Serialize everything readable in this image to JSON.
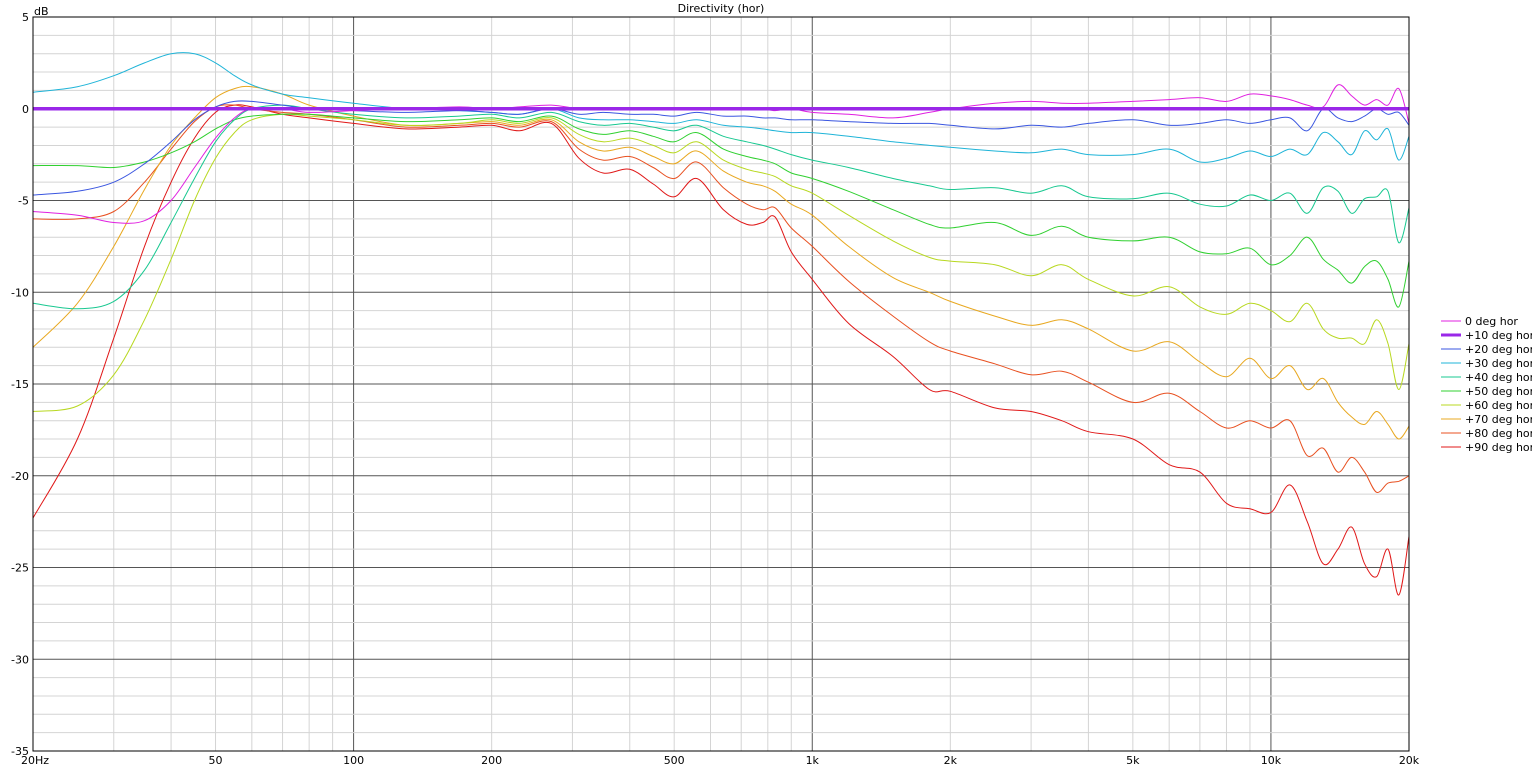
{
  "chart_data": {
    "type": "line",
    "title": "Directivity (hor)",
    "ylabel": "dB",
    "xlabel": "",
    "xscale": "log",
    "xlim": [
      20,
      20000
    ],
    "ylim": [
      -35,
      5
    ],
    "grid": true,
    "legend_placement": "right",
    "x_ticks": [
      {
        "v": 20,
        "label": "20Hz"
      },
      {
        "v": 50,
        "label": "50"
      },
      {
        "v": 100,
        "label": "100"
      },
      {
        "v": 200,
        "label": "200"
      },
      {
        "v": 500,
        "label": "500"
      },
      {
        "v": 1000,
        "label": "1k"
      },
      {
        "v": 2000,
        "label": "2k"
      },
      {
        "v": 5000,
        "label": "5k"
      },
      {
        "v": 10000,
        "label": "10k"
      },
      {
        "v": 20000,
        "label": "20k"
      }
    ],
    "y_ticks": [
      {
        "v": 5,
        "label": "5"
      },
      {
        "v": 0,
        "label": "0"
      },
      {
        "v": -5,
        "label": "-5"
      },
      {
        "v": -10,
        "label": "-10"
      },
      {
        "v": -15,
        "label": "-15"
      },
      {
        "v": -20,
        "label": "-20"
      },
      {
        "v": -25,
        "label": "-25"
      },
      {
        "v": -30,
        "label": "-30"
      },
      {
        "v": -35,
        "label": "-35"
      }
    ],
    "x": [
      20,
      25,
      30,
      35,
      40,
      45,
      50,
      55,
      60,
      70,
      80,
      100,
      130,
      170,
      200,
      230,
      270,
      310,
      350,
      400,
      450,
      500,
      560,
      640,
      720,
      780,
      830,
      900,
      1000,
      1200,
      1500,
      1800,
      2000,
      2500,
      3000,
      3500,
      4000,
      5000,
      6000,
      7000,
      8000,
      9000,
      10000,
      11000,
      12000,
      13000,
      14000,
      15000,
      16000,
      17000,
      18000,
      19000,
      20000
    ],
    "series": [
      {
        "name": "0 deg hor",
        "color": "#e020e0",
        "width": 1,
        "values": [
          -5.6,
          -5.8,
          -6.2,
          -6.1,
          -5,
          -3.2,
          -1.6,
          -0.5,
          0,
          0,
          -0.2,
          -0.1,
          0,
          0.1,
          0,
          0.1,
          0.2,
          0,
          0,
          0,
          0,
          0,
          0,
          0,
          0,
          0,
          -0.1,
          0,
          -0.2,
          -0.3,
          -0.5,
          -0.2,
          0,
          0.3,
          0.4,
          0.3,
          0.3,
          0.4,
          0.5,
          0.6,
          0.4,
          0.8,
          0.7,
          0.5,
          0.2,
          0.1,
          1.3,
          0.7,
          0.2,
          0.5,
          0.2,
          1.1,
          -0.8
        ]
      },
      {
        "name": "+10 deg hor",
        "color": "#9a28e8",
        "width": 3.5,
        "values": [
          0,
          0,
          0,
          0,
          0,
          0,
          0,
          0,
          0,
          0,
          0,
          0,
          0,
          0,
          0,
          0,
          0,
          0,
          0,
          0,
          0,
          0,
          0,
          0,
          0,
          0,
          0,
          0,
          0,
          0,
          0,
          0,
          0,
          0,
          0,
          0,
          0,
          0,
          0,
          0,
          0,
          0,
          0,
          0,
          0,
          0,
          0,
          0,
          0,
          0,
          0,
          0,
          0
        ]
      },
      {
        "name": "+20 deg hor",
        "color": "#3a56e0",
        "width": 1,
        "values": [
          -4.7,
          -4.5,
          -4.0,
          -3.0,
          -1.8,
          -0.6,
          0.1,
          0.4,
          0.4,
          0.2,
          0,
          -0.1,
          -0.2,
          -0.1,
          -0.2,
          -0.3,
          0,
          -0.3,
          -0.2,
          -0.3,
          -0.3,
          -0.4,
          -0.2,
          -0.4,
          -0.4,
          -0.5,
          -0.5,
          -0.6,
          -0.6,
          -0.7,
          -0.8,
          -0.8,
          -0.9,
          -1.1,
          -0.9,
          -1.0,
          -0.8,
          -0.6,
          -0.9,
          -0.8,
          -0.6,
          -0.8,
          -0.6,
          -0.5,
          -1.2,
          0,
          -0.5,
          -0.7,
          -0.4,
          0,
          -0.3,
          -0.2,
          -0.9
        ]
      },
      {
        "name": "+30 deg hor",
        "color": "#1fb4d8",
        "width": 1,
        "values": [
          0.9,
          1.2,
          1.8,
          2.5,
          3.0,
          3.0,
          2.5,
          1.8,
          1.3,
          0.8,
          0.6,
          0.3,
          0,
          -0.1,
          -0.2,
          -0.3,
          0,
          -0.5,
          -0.6,
          -0.6,
          -0.7,
          -0.8,
          -0.6,
          -0.9,
          -1.0,
          -1.1,
          -1.2,
          -1.3,
          -1.3,
          -1.5,
          -1.8,
          -2.0,
          -2.1,
          -2.3,
          -2.4,
          -2.2,
          -2.5,
          -2.5,
          -2.2,
          -2.9,
          -2.7,
          -2.3,
          -2.6,
          -2.2,
          -2.5,
          -1.3,
          -1.8,
          -2.5,
          -1.2,
          -1.7,
          -1.1,
          -2.8,
          -1.5
        ]
      },
      {
        "name": "+40 deg hor",
        "color": "#18c890",
        "width": 1,
        "values": [
          -10.6,
          -10.9,
          -10.5,
          -8.8,
          -6.2,
          -3.8,
          -1.8,
          -0.6,
          0,
          0.2,
          0,
          -0.3,
          -0.5,
          -0.4,
          -0.3,
          -0.5,
          -0.2,
          -0.7,
          -0.9,
          -0.8,
          -1.0,
          -1.2,
          -0.9,
          -1.5,
          -1.8,
          -2.0,
          -2.2,
          -2.5,
          -2.8,
          -3.2,
          -3.8,
          -4.2,
          -4.4,
          -4.3,
          -4.6,
          -4.2,
          -4.8,
          -4.9,
          -4.6,
          -5.2,
          -5.3,
          -4.7,
          -5.0,
          -4.6,
          -5.7,
          -4.3,
          -4.5,
          -5.7,
          -4.9,
          -4.8,
          -4.5,
          -7.3,
          -5.4
        ]
      },
      {
        "name": "+50 deg hor",
        "color": "#30d030",
        "width": 1,
        "values": [
          -3.1,
          -3.1,
          -3.2,
          -2.9,
          -2.4,
          -1.8,
          -1.1,
          -0.6,
          -0.4,
          -0.3,
          -0.3,
          -0.5,
          -0.7,
          -0.6,
          -0.5,
          -0.7,
          -0.4,
          -1.1,
          -1.4,
          -1.2,
          -1.5,
          -1.8,
          -1.3,
          -2.2,
          -2.6,
          -2.8,
          -3.0,
          -3.5,
          -3.8,
          -4.5,
          -5.5,
          -6.3,
          -6.5,
          -6.2,
          -6.9,
          -6.4,
          -7.0,
          -7.2,
          -7.0,
          -7.8,
          -7.9,
          -7.6,
          -8.5,
          -8.0,
          -7.0,
          -8.2,
          -8.8,
          -9.5,
          -8.6,
          -8.3,
          -9.3,
          -10.8,
          -8.3
        ]
      },
      {
        "name": "+60 deg hor",
        "color": "#b8d820",
        "width": 1,
        "values": [
          -16.5,
          -16.2,
          -14.5,
          -11.5,
          -8.2,
          -5.0,
          -2.7,
          -1.3,
          -0.6,
          -0.3,
          -0.4,
          -0.6,
          -0.9,
          -0.8,
          -0.6,
          -0.8,
          -0.5,
          -1.4,
          -1.8,
          -1.6,
          -2.0,
          -2.4,
          -1.8,
          -2.8,
          -3.3,
          -3.5,
          -3.7,
          -4.2,
          -4.6,
          -5.8,
          -7.2,
          -8.1,
          -8.3,
          -8.5,
          -9.1,
          -8.5,
          -9.3,
          -10.2,
          -9.7,
          -10.8,
          -11.2,
          -10.6,
          -11.0,
          -11.6,
          -10.6,
          -12.0,
          -12.5,
          -12.5,
          -12.8,
          -11.5,
          -12.8,
          -15.3,
          -12.8
        ]
      },
      {
        "name": "+70 deg hor",
        "color": "#e8a820",
        "width": 1,
        "values": [
          -13.0,
          -10.6,
          -7.5,
          -4.4,
          -2.0,
          -0.5,
          0.6,
          1.1,
          1.2,
          0.8,
          0.2,
          -0.4,
          -0.9,
          -0.8,
          -0.7,
          -0.9,
          -0.6,
          -1.8,
          -2.3,
          -2.1,
          -2.6,
          -3.0,
          -2.3,
          -3.4,
          -4.0,
          -4.2,
          -4.5,
          -5.2,
          -5.8,
          -7.5,
          -9.2,
          -10.0,
          -10.5,
          -11.3,
          -11.8,
          -11.5,
          -12.0,
          -13.2,
          -12.7,
          -13.8,
          -14.6,
          -13.6,
          -14.7,
          -14.0,
          -15.3,
          -14.7,
          -16.0,
          -16.8,
          -17.2,
          -16.5,
          -17.2,
          -18.0,
          -17.3
        ]
      },
      {
        "name": "+80 deg hor",
        "color": "#e85020",
        "width": 1,
        "values": [
          -6.0,
          -6.0,
          -5.6,
          -4.0,
          -2.2,
          -0.7,
          0.1,
          0.2,
          0,
          -0.2,
          -0.3,
          -0.6,
          -1.0,
          -0.9,
          -0.8,
          -1.0,
          -0.7,
          -2.2,
          -2.8,
          -2.6,
          -3.2,
          -3.8,
          -2.9,
          -4.3,
          -5.2,
          -5.5,
          -5.4,
          -6.5,
          -7.5,
          -9.4,
          -11.3,
          -12.7,
          -13.2,
          -13.9,
          -14.5,
          -14.3,
          -14.9,
          -16.0,
          -15.5,
          -16.5,
          -17.4,
          -17.0,
          -17.4,
          -17.0,
          -18.9,
          -18.5,
          -19.8,
          -19.0,
          -19.8,
          -20.9,
          -20.4,
          -20.3,
          -20.0
        ]
      },
      {
        "name": "+90 deg hor",
        "color": "#e01818",
        "width": 1,
        "values": [
          -22.3,
          -18.0,
          -12.5,
          -7.5,
          -4.0,
          -1.6,
          -0.2,
          0.2,
          0.1,
          -0.3,
          -0.5,
          -0.8,
          -1.1,
          -1.0,
          -0.9,
          -1.2,
          -0.8,
          -2.7,
          -3.5,
          -3.3,
          -4.1,
          -4.8,
          -3.8,
          -5.5,
          -6.3,
          -6.2,
          -5.9,
          -7.8,
          -9.3,
          -11.7,
          -13.5,
          -15.3,
          -15.4,
          -16.3,
          -16.5,
          -17.0,
          -17.6,
          -18.0,
          -19.4,
          -19.8,
          -21.5,
          -21.8,
          -22.0,
          -20.5,
          -22.5,
          -24.8,
          -24.0,
          -22.8,
          -24.8,
          -25.5,
          -24.0,
          -26.5,
          -23.3
        ]
      }
    ]
  }
}
